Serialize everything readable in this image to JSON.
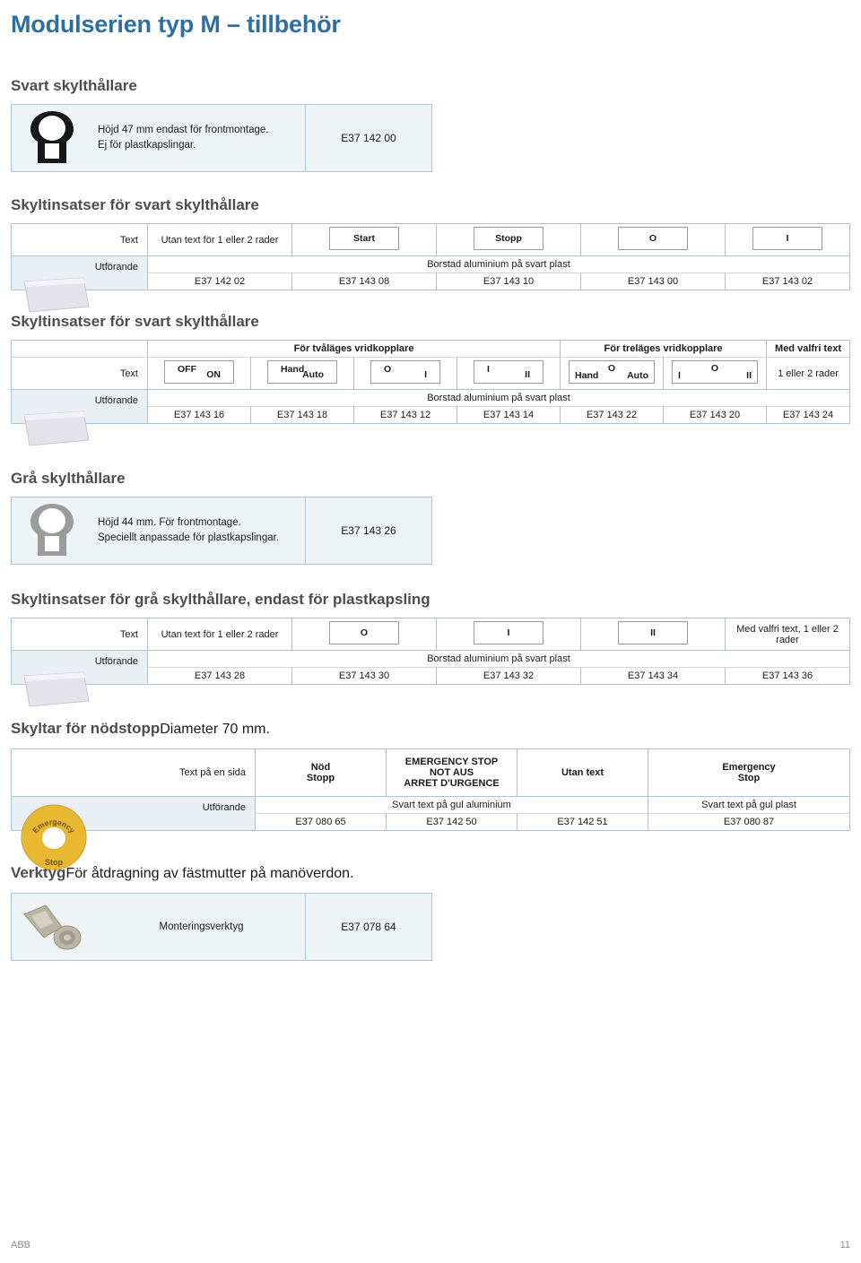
{
  "title": "Modulserien typ M – tillbehör",
  "colors": {
    "title_blue": "#2e6fa3",
    "table_border": "#a9c6d6",
    "shade": "#e9eff3",
    "panel": "#eef3f6",
    "emergency_yellow": "#e8b833"
  },
  "sections": {
    "black_holder": {
      "heading": "Svart skylthållare",
      "desc_line1": "Höjd 47 mm endast för frontmontage.",
      "desc_line2": "Ej för plastkapslingar.",
      "code": "E37 142 00",
      "image_name": "black-label-holder-photo"
    },
    "black_inserts": {
      "heading": "Skyltinsatser för svart skylthållare",
      "label_text": "Text",
      "label_exec": "Utförande",
      "exec_value": "Borstad aluminium på svart plast",
      "columns": [
        {
          "text": "Utan text för 1 eller 2 rader",
          "boxed": false,
          "code": "E37 142 02"
        },
        {
          "text": "Start",
          "boxed": true,
          "code": "E37 143 08"
        },
        {
          "text": "Stopp",
          "boxed": true,
          "code": "E37 143 10"
        },
        {
          "text": "O",
          "boxed": true,
          "code": "E37 143 00"
        },
        {
          "text": "I",
          "boxed": true,
          "code": "E37 143 02"
        }
      ],
      "image_name": "label-insert-photo"
    },
    "black_inserts2": {
      "heading": "Skyltinsatser för svart skylthållare",
      "label_text": "Text",
      "label_exec": "Utförande",
      "exec_value": "Borstad aluminium på svart plast",
      "groups": [
        {
          "label": "För tvåläges vridkopplare",
          "span": 4
        },
        {
          "label": "För treläges vridkopplare",
          "span": 2
        },
        {
          "label": "Med valfri text",
          "span": 1
        }
      ],
      "columns": [
        {
          "style": "two",
          "top": "OFF",
          "bottom": "ON",
          "code": "E37 143 16"
        },
        {
          "style": "two",
          "top": "Hand",
          "bottom": "Auto",
          "code": "E37 143 18"
        },
        {
          "style": "two",
          "top": "O",
          "bottom": "I",
          "code": "E37 143 12"
        },
        {
          "style": "two",
          "top": "I",
          "bottom": "II",
          "code": "E37 143 14"
        },
        {
          "style": "three",
          "top": "O",
          "left": "Hand",
          "right": "Auto",
          "code": "E37 143 22"
        },
        {
          "style": "three",
          "top": "O",
          "left": "I",
          "right": "II",
          "code": "E37 143 20"
        },
        {
          "style": "plain",
          "text": "1 eller 2 rader",
          "code": "E37 143 24"
        }
      ],
      "image_name": "label-insert-photo"
    },
    "grey_holder": {
      "heading": "Grå skylthållare",
      "desc_line1": "Höjd 44 mm. För frontmontage.",
      "desc_line2": "Speciellt anpassade för plastkapslingar.",
      "code": "E37 143 26",
      "image_name": "grey-label-holder-photo"
    },
    "grey_inserts": {
      "heading": "Skyltinsatser för grå skylthållare, endast för plastkapsling",
      "label_text": "Text",
      "label_exec": "Utförande",
      "exec_value": "Borstad aluminium på svart plast",
      "columns": [
        {
          "text": "Utan text för 1 eller 2 rader",
          "boxed": false,
          "code": "E37 143 28"
        },
        {
          "text": "O",
          "boxed": true,
          "code": "E37 143 30"
        },
        {
          "text": "I",
          "boxed": true,
          "code": "E37 143 32"
        },
        {
          "text": "II",
          "boxed": true,
          "code": "E37 143 34"
        },
        {
          "text": "Med valfri text, 1 eller 2 rader",
          "boxed": false,
          "code": "E37 143 36"
        }
      ],
      "image_name": "label-insert-photo"
    },
    "emergency": {
      "heading": "Skyltar för nödstopp",
      "heading_sub": "Diameter 70 mm.",
      "label_text": "Text på en sida",
      "label_exec": "Utförande",
      "exec_alu": "Svart text på gul aluminium",
      "exec_plast": "Svart text på gul plast",
      "columns": [
        {
          "lines": [
            "Nöd",
            "Stopp"
          ],
          "code": "E37 080 65"
        },
        {
          "lines": [
            "EMERGENCY STOP",
            "NOT AUS",
            "ARRET D'URGENCE"
          ],
          "code": "E37 142 50"
        },
        {
          "lines": [
            "Utan text"
          ],
          "code": "E37 142 51"
        },
        {
          "lines": [
            "Emergency",
            "Stop"
          ],
          "code": "E37 080 87"
        }
      ],
      "image_name": "emergency-stop-disc-photo",
      "disc_top_text": "Emergency",
      "disc_bottom_text": "Stop"
    },
    "tools": {
      "heading": "Verktyg",
      "heading_sub": "För åtdragning av fästmutter på manöverdon.",
      "desc": "Monteringsverktyg",
      "code": "E37 078 64",
      "image_name": "mounting-tool-photo"
    }
  },
  "footer": {
    "brand": "ABB",
    "page_number": "11"
  }
}
